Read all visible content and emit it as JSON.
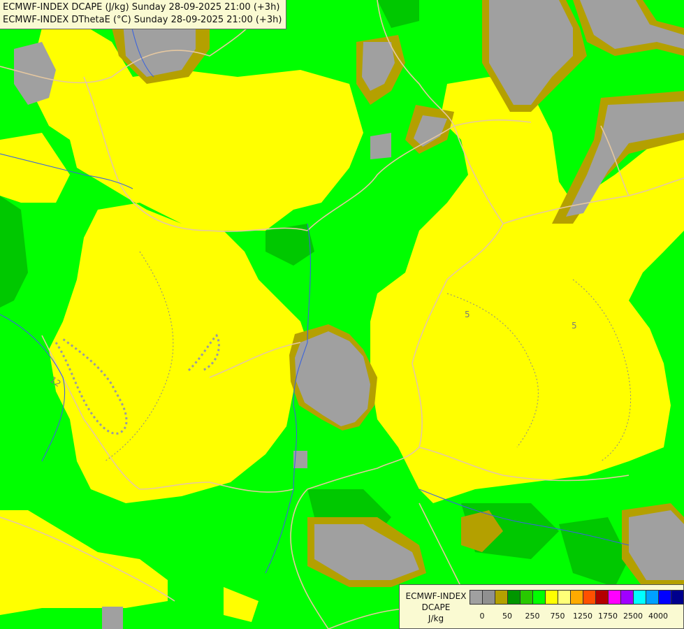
{
  "titles": [
    "ECMWF-INDEX DCAPE (J/kg) Sunday 28-09-2025 21:00 (+3h)",
    "ECMWF-INDEX DThetaE (°C) Sunday 28-09-2025 21:00 (+3h)"
  ],
  "legend": {
    "lines": [
      "ECMWF-INDEX",
      "DCAPE",
      "J/kg"
    ],
    "swatch_colors": [
      "#a0a0a0",
      "#909090",
      "#b4a000",
      "#009600",
      "#28c800",
      "#00ff00",
      "#ffff00",
      "#ffff78",
      "#ffaa00",
      "#ff5000",
      "#b40000",
      "#ff00ff",
      "#a000ff",
      "#00ffff",
      "#00a0ff",
      "#0000ff",
      "#00008c"
    ],
    "tick_labels": [
      "0",
      "50",
      "250",
      "750",
      "1250",
      "1750",
      "2500",
      "4000"
    ]
  },
  "contour_labels": [
    "5",
    "5",
    "12"
  ],
  "colors": {
    "green": "#00ff00",
    "dark_green": "#00c800",
    "yellow": "#ffff00",
    "grey": "#a0a0a0",
    "olive": "#b4a000",
    "border_line": "#e6c8a0",
    "river": "#3c64dc"
  }
}
